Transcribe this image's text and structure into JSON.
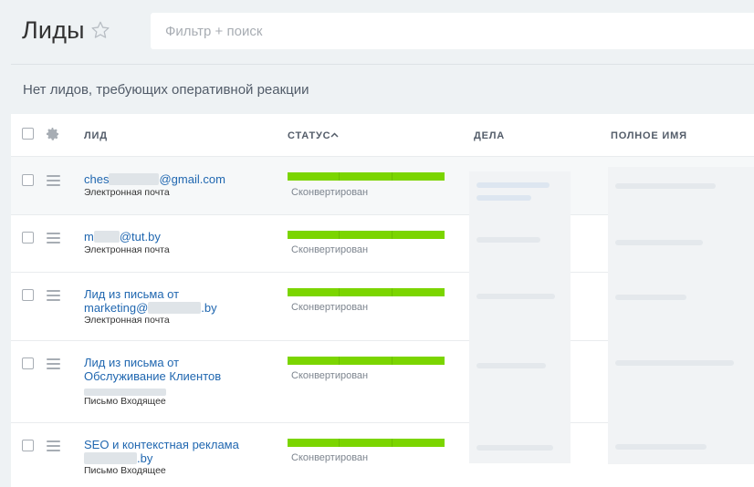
{
  "header": {
    "title": "Лиды",
    "search_placeholder": "Фильтр + поиск"
  },
  "notice": "Нет лидов, требующих оперативной реакции",
  "columns": {
    "lead": "ЛИД",
    "status": "СТАТУС",
    "deals": "ДЕЛА",
    "full_name": "ПОЛНОЕ ИМЯ"
  },
  "rows": [
    {
      "name_a": "ches",
      "name_b": "@gmail.com",
      "source": "Электронная почта",
      "status": "Сконвертирован"
    },
    {
      "name_a": "m",
      "name_b": "@tut.by",
      "source": "Электронная почта",
      "status": "Сконвертирован"
    },
    {
      "name_line1": "Лид из письма от",
      "name_a": "marketing@",
      "name_b": ".by",
      "source": "Электронная почта",
      "status": "Сконвертирован"
    },
    {
      "name_line1": "Лид из письма от",
      "name_line2": "Обслуживание Клиентов",
      "source": "Письмо Входящее",
      "status": "Сконвертирован"
    },
    {
      "name_line1": "SEO и контекстная реклама",
      "name_b": ".by",
      "source": "Письмо Входящее",
      "status": "Сконвертирован"
    }
  ],
  "colors": {
    "accent_link": "#2067b0",
    "status_green": "#7bd500",
    "background": "#eef2f4"
  },
  "icons": [
    "star-icon",
    "gear-icon",
    "drag-handle-icon",
    "sort-ascending-icon"
  ]
}
